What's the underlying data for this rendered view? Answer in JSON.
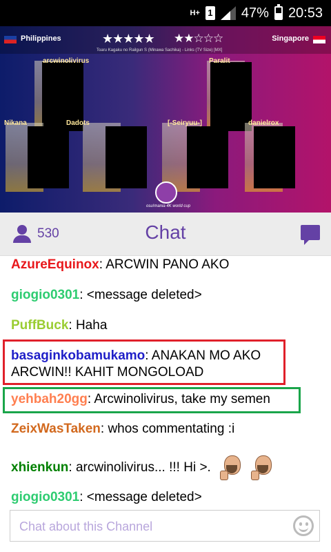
{
  "status_bar": {
    "network": "H+",
    "sim": "1",
    "battery": "47%",
    "time": "20:53"
  },
  "stream": {
    "left_country": "Philippines",
    "right_country": "Singapore",
    "left_stars": "★★★★★",
    "right_stars": "★★☆☆☆",
    "song": "Toaru Kagaku no Railgun S (Minawa Sachika) - Links (TV Size) [MX]",
    "players": [
      "arcwinolivirus",
      "Paralit",
      "Nikana",
      "Dadots",
      "[-Seiryuu-]",
      "danielrox"
    ],
    "logo_text": "osu!mania 4K world cup"
  },
  "chat_header": {
    "viewer_count": "530",
    "title": "Chat"
  },
  "messages": [
    {
      "user": "AzureEquinox",
      "text": ": ARCWIN PANO AKO",
      "color": "#e8181c"
    },
    {
      "user": "giogio0301",
      "text": ": <message deleted>",
      "color": "#2ecc71"
    },
    {
      "user": "PuffBuck",
      "text": ": Haha",
      "color": "#9acd32"
    },
    {
      "user": "basaginkobamukamo",
      "text": ": ANAKAN MO AKO ARCWIN!! KAHIT MONGOLOAD",
      "color": "#1f1fc8"
    },
    {
      "user": "yehbah20gg",
      "text": ": Arcwinolivirus, take my semen",
      "color": "#ff7f50"
    },
    {
      "user": "ZeixWasTaken",
      "text": ": whos commentating :i",
      "color": "#d2691e"
    },
    {
      "user": "xhienkun",
      "text": ": arcwinolivirus... !!! Hi >.",
      "color": "#008000"
    },
    {
      "user": "giogio0301",
      "text": ": <message deleted>",
      "color": "#2ecc71"
    }
  ],
  "highlights": {
    "red": "#e0202a",
    "green": "#1aa54a"
  },
  "input": {
    "placeholder": "Chat about this Channel"
  }
}
